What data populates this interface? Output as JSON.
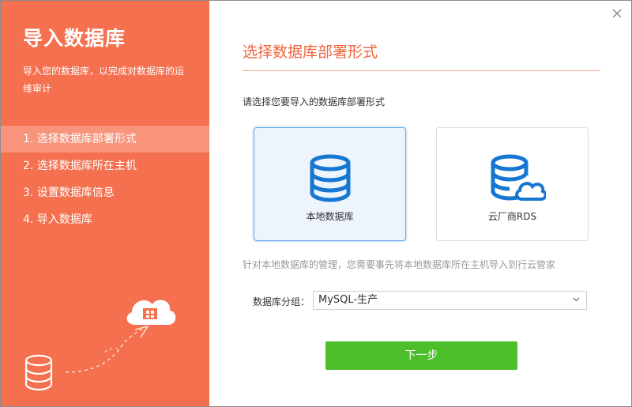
{
  "sidebar": {
    "title": "导入数据库",
    "description": "导入您的数据库，以完成对数据库的运维审计",
    "steps": [
      {
        "label": "1. 选择数据库部署形式",
        "active": true
      },
      {
        "label": "2. 选择数据库所在主机",
        "active": false
      },
      {
        "label": "3. 设置数据库信息",
        "active": false
      },
      {
        "label": "4. 导入数据库",
        "active": false
      }
    ]
  },
  "main": {
    "title": "选择数据库部署形式",
    "prompt": "请选择您要导入的数据库部署形式",
    "options": [
      {
        "label": "本地数据库",
        "icon": "database-icon",
        "selected": true
      },
      {
        "label": "云厂商RDS",
        "icon": "cloud-database-icon",
        "selected": false
      }
    ],
    "hint": "针对本地数据库的管理，您需要事先将本地数据库所在主机导入到行云管家",
    "group_label": "数据库分组：",
    "group_value": "MySQL-生产",
    "next_label": "下一步"
  },
  "colors": {
    "sidebar_bg": "#f4704f",
    "accent": "#f0643c",
    "primary_blue": "#1677d2",
    "button_green": "#4cbf2a"
  }
}
